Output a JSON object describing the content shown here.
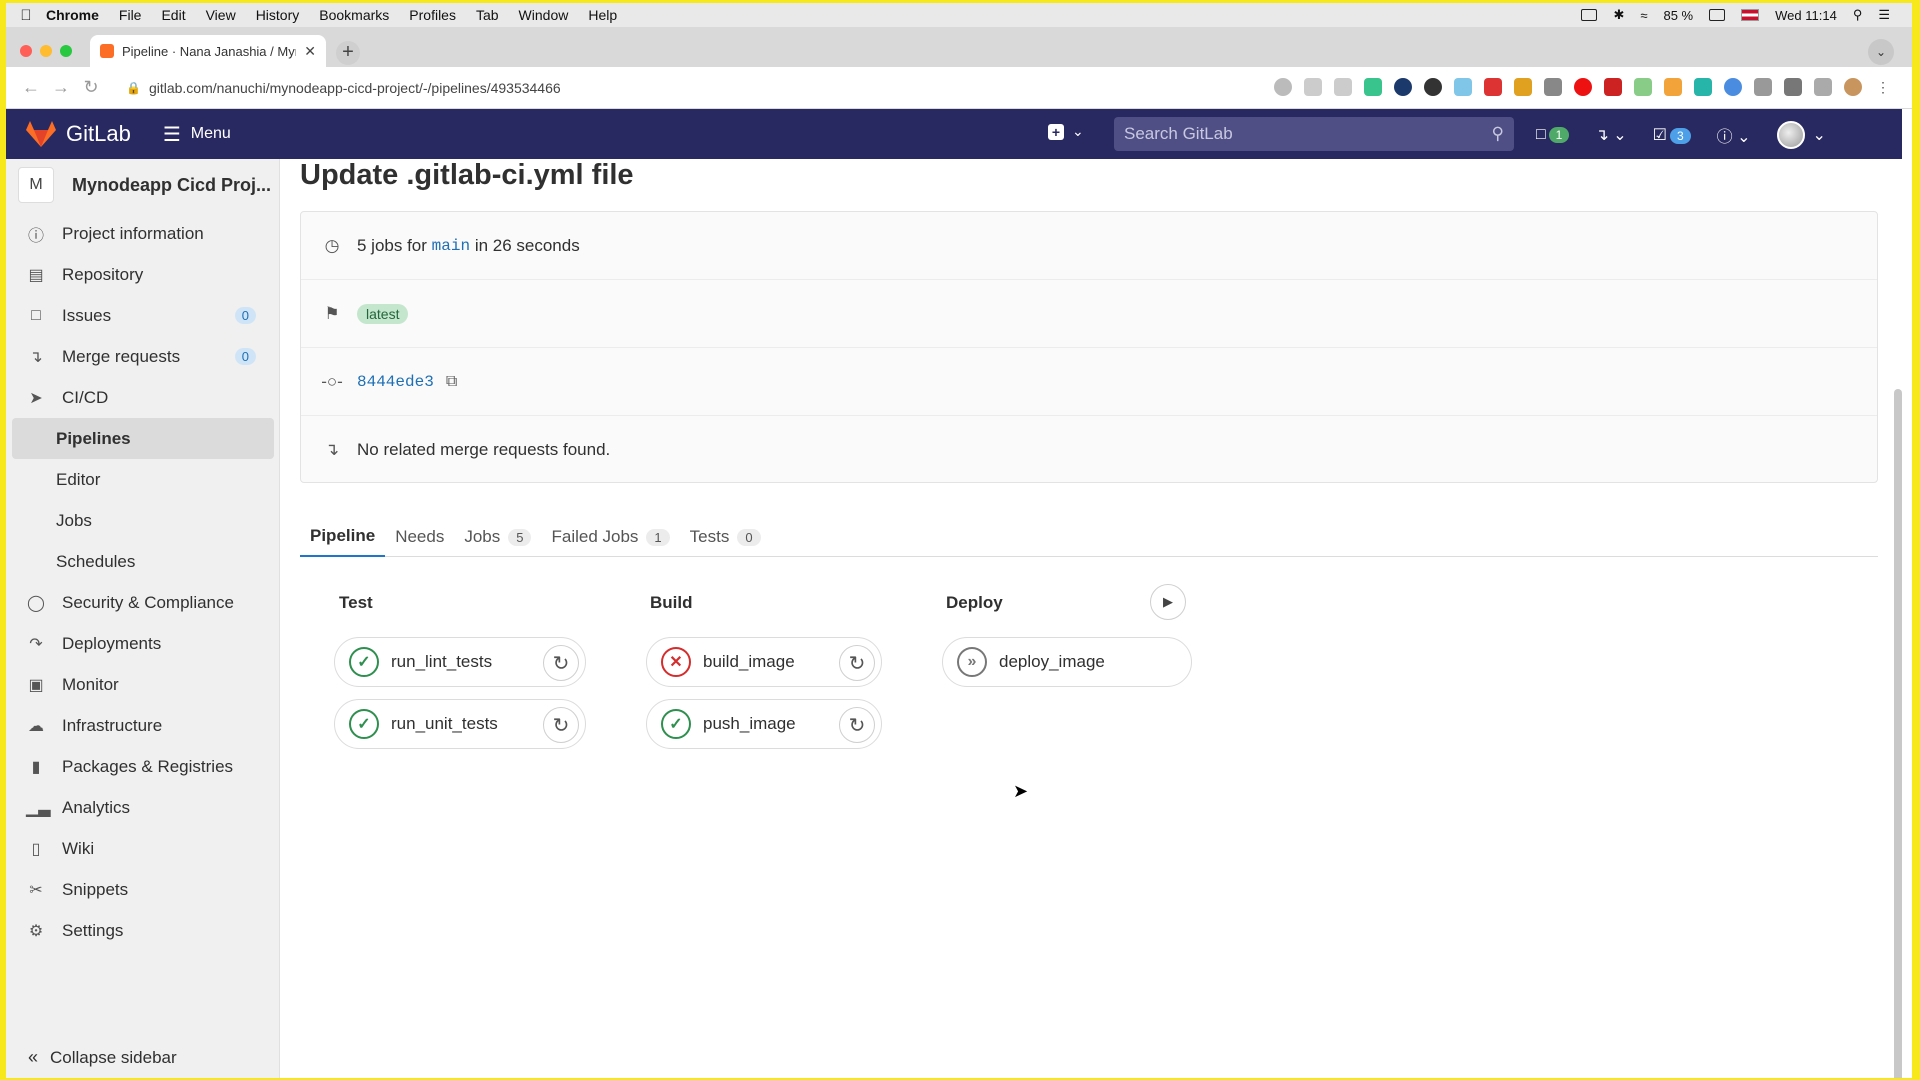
{
  "macbar": {
    "app": "Chrome",
    "menu": [
      "File",
      "Edit",
      "View",
      "History",
      "Bookmarks",
      "Profiles",
      "Tab",
      "Window",
      "Help"
    ],
    "battery": "85 %",
    "clock": "Wed 11:14"
  },
  "browser": {
    "tab_title": "Pipeline · Nana Janashia / Myn",
    "url": "gitlab.com/nanuchi/mynodeapp-cicd-project/-/pipelines/493534466"
  },
  "header": {
    "logo": "GitLab",
    "menu_label": "Menu",
    "search_placeholder": "Search GitLab",
    "issues_count": "1",
    "todos_count": "3"
  },
  "sidebar": {
    "project_initial": "M",
    "project_name": "Mynodeapp Cicd Proj...",
    "items": [
      {
        "label": "Project information",
        "icon": "info-icon"
      },
      {
        "label": "Repository",
        "icon": "doc-icon"
      },
      {
        "label": "Issues",
        "icon": "issues-icon",
        "count": "0"
      },
      {
        "label": "Merge requests",
        "icon": "merge-icon",
        "count": "0"
      },
      {
        "label": "CI/CD",
        "icon": "rocket-icon"
      },
      {
        "label": "Pipelines"
      },
      {
        "label": "Editor"
      },
      {
        "label": "Jobs"
      },
      {
        "label": "Schedules"
      },
      {
        "label": "Security & Compliance",
        "icon": "shield-icon"
      },
      {
        "label": "Deployments",
        "icon": "deploy-icon"
      },
      {
        "label": "Monitor",
        "icon": "monitor-icon"
      },
      {
        "label": "Infrastructure",
        "icon": "cloud-icon"
      },
      {
        "label": "Packages & Registries",
        "icon": "package-icon"
      },
      {
        "label": "Analytics",
        "icon": "chart-icon"
      },
      {
        "label": "Wiki",
        "icon": "book-icon"
      },
      {
        "label": "Snippets",
        "icon": "scissors-icon"
      },
      {
        "label": "Settings",
        "icon": "gear-icon"
      }
    ],
    "collapse_label": "Collapse sidebar"
  },
  "main": {
    "title": "Update .gitlab-ci.yml file",
    "summary_prefix": "5 jobs for",
    "branch": "main",
    "summary_suffix": "in 26 seconds",
    "tag": "latest",
    "commit": "8444ede3",
    "merge_info": "No related merge requests found.",
    "tabs": [
      {
        "label": "Pipeline"
      },
      {
        "label": "Needs"
      },
      {
        "label": "Jobs",
        "count": "5"
      },
      {
        "label": "Failed Jobs",
        "count": "1"
      },
      {
        "label": "Tests",
        "count": "0"
      }
    ],
    "stages": [
      {
        "name": "Test",
        "jobs": [
          {
            "name": "run_lint_tests",
            "status": "passed"
          },
          {
            "name": "run_unit_tests",
            "status": "passed"
          }
        ]
      },
      {
        "name": "Build",
        "jobs": [
          {
            "name": "build_image",
            "status": "failed"
          },
          {
            "name": "push_image",
            "status": "passed"
          }
        ]
      },
      {
        "name": "Deploy",
        "jobs": [
          {
            "name": "deploy_image",
            "status": "skipped"
          }
        ]
      }
    ]
  },
  "colors": {
    "header_bg": "#292961",
    "accent": "#1f75cb",
    "success": "#2f8f4e",
    "failed": "#d42d2d"
  }
}
